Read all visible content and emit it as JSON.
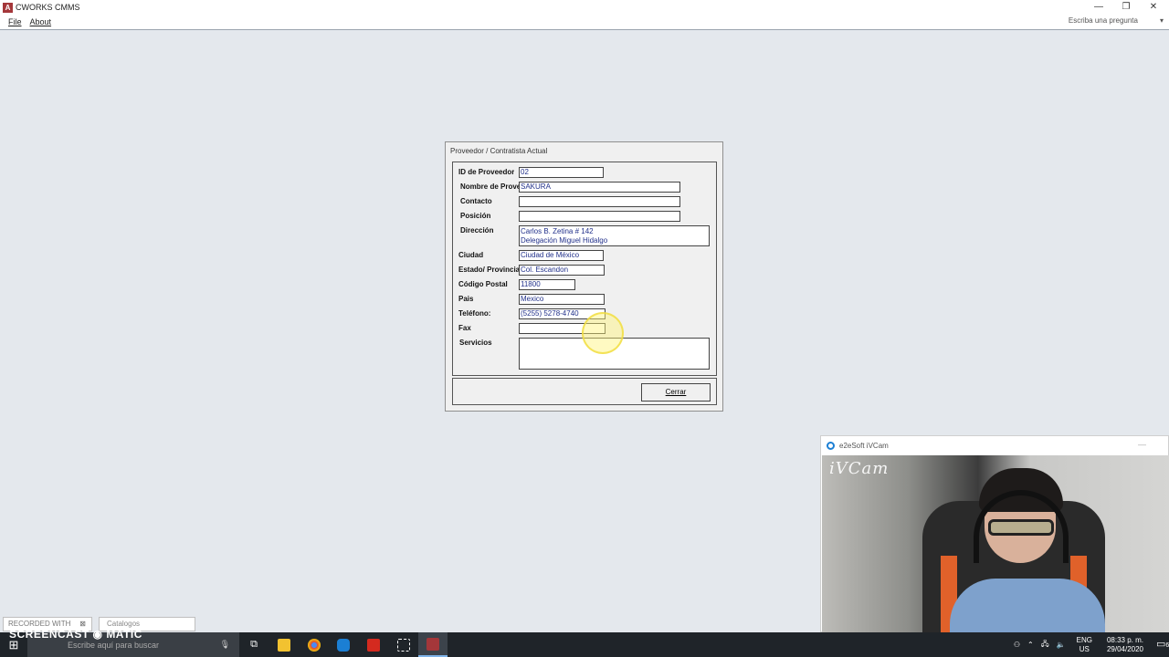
{
  "window": {
    "title": "CWORKS CMMS",
    "app_icon": "A",
    "minimize_glyph": "—",
    "restore_glyph": "❐",
    "close_glyph": "✕"
  },
  "menu": {
    "items": [
      "File",
      "About"
    ],
    "ask_placeholder": "Escriba una pregunta",
    "ask_arrow": "▾"
  },
  "dialog": {
    "title": "Proveedor / Contratista Actual",
    "fields": {
      "id_label": "ID de Proveedor",
      "id_value": "02",
      "nombre_label": "Nombre de Prove",
      "nombre_value": "SAKURA",
      "contacto_label": "Contacto",
      "contacto_value": "",
      "posicion_label": "Posición",
      "posicion_value": "",
      "direccion_label": "Dirección",
      "direccion_line1": "Carlos B. Zetina # 142",
      "direccion_line2": "Delegación Miguel Hidalgo",
      "ciudad_label": "Ciudad",
      "ciudad_value": "Ciudad de México",
      "estado_label": "Estado/ Provincia",
      "estado_value": "Col. Escandon",
      "cp_label": "Código Postal",
      "cp_value": "11800",
      "pais_label": "Pais",
      "pais_value": "Mexico",
      "telefono_label": "Teléfono:",
      "telefono_value": "(5255) 5278-4740",
      "fax_label": "Fax",
      "fax_value": "",
      "servicios_label": "Servicios",
      "servicios_value": ""
    },
    "close_button": "Cerrar"
  },
  "webcam": {
    "title": "e2eSoft iVCam",
    "overlay_logo": "iVCam",
    "minimize_glyph": "—"
  },
  "bottom_tabs": {
    "recorded_label": "RECORDED WITH",
    "recorded_close": "⊠",
    "catalogos_label": "Catalogos"
  },
  "taskbar": {
    "search_placeholder": "Escribe aquí para buscar",
    "watermark": "SCREENCAST ◉ MATIC",
    "tray_lang_top": "ENG",
    "tray_lang_bottom": "US",
    "time": "08:33 p. m.",
    "date": "29/04/2020",
    "notification_count": "6"
  },
  "colors": {
    "desktop_bg": "#e4e8ed",
    "field_text": "#21308a",
    "taskbar_bg": "#1f2429",
    "access_red": "#a4373a"
  }
}
